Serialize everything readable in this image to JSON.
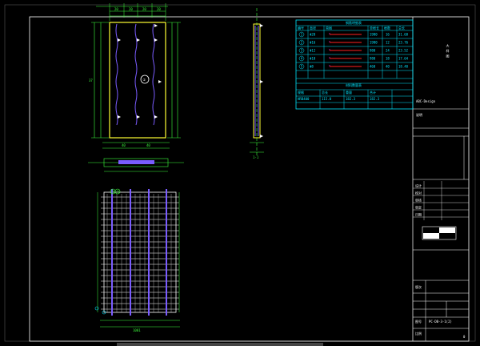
{
  "colors": {
    "background": "#000000",
    "frame": "#ffffff",
    "slab_outline": "#ffff33",
    "dimension": "#3cff3c",
    "rebar_main": "#7a5cff",
    "rebar_grid": "#ffffff",
    "table": "#00e5ff",
    "accent_red": "#ff2020",
    "accent_magenta": "#ff33ff"
  },
  "plan_view": {
    "top_dims": [
      "20",
      "20",
      "20",
      "20"
    ],
    "center_symbol": "①",
    "bottom_dims": [
      "40",
      "40"
    ],
    "side_dim": "37"
  },
  "section_view": {
    "label": "1-1"
  },
  "rebar_view": {
    "bubbles": [
      "①",
      "②"
    ],
    "bottom_label": "1001"
  },
  "material_table": {
    "title": "钢筋明细表",
    "headers": [
      "编号",
      "直径",
      "简图",
      "单根长",
      "根数",
      "总长"
    ],
    "rows": [
      {
        "id": "1",
        "dia": "Φ20",
        "len": "1980",
        "count": "16",
        "total": "31.68"
      },
      {
        "id": "2",
        "dia": "Φ16",
        "len": "1980",
        "count": "12",
        "total": "23.76"
      },
      {
        "id": "3",
        "dia": "Φ12",
        "len": "980",
        "count": "24",
        "total": "23.52"
      },
      {
        "id": "4",
        "dia": "Φ10",
        "len": "980",
        "count": "18",
        "total": "17.64"
      },
      {
        "id": "5",
        "dia": "Φ8",
        "len": "460",
        "count": "40",
        "total": "18.40"
      }
    ],
    "summary_title": "材料数量表",
    "summary_headers": [
      "规格",
      "总长",
      "重量",
      "合计"
    ],
    "summary_row": [
      "HRB400",
      "115.0",
      "182.3",
      "182.3"
    ]
  },
  "title_block": {
    "side_text": "大 样 图",
    "stamp": "ABC-Design",
    "notes_label": "说明",
    "rows": [
      "设计",
      "校对",
      "审核",
      "审定",
      "日期"
    ],
    "revision_label": "版次",
    "drawing_no_label": "图号",
    "drawing_no": "PC-DB-3-1(2)",
    "scale_label": "比例",
    "sheet": "0"
  }
}
